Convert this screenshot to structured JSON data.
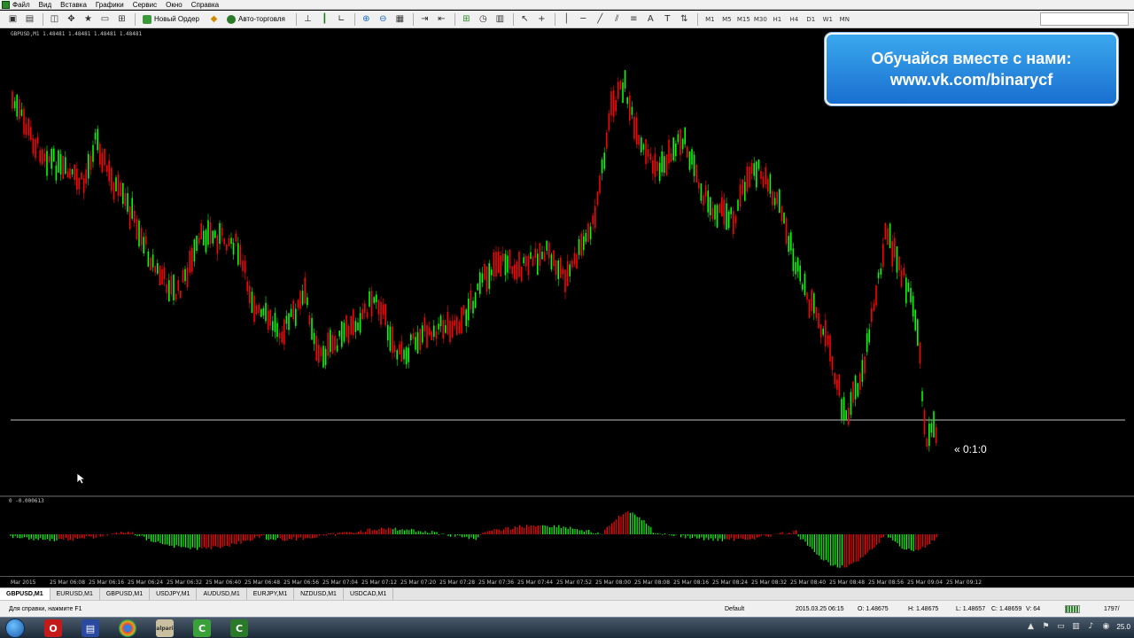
{
  "menu": [
    "Файл",
    "Вид",
    "Вставка",
    "Графики",
    "Сервис",
    "Окно",
    "Справка"
  ],
  "toolbar": {
    "new_order_label": "Новый Ордер",
    "autotrade_label": "Авто-торговля",
    "timeframes": [
      "M1",
      "M5",
      "M15",
      "M30",
      "H1",
      "H4",
      "D1",
      "W1",
      "MN"
    ]
  },
  "chart": {
    "title": "GBPUSD,M1  1.48481 1.48481 1.48481 1.48481",
    "timer": "« 0:1:0",
    "up_color": "#00ff00",
    "down_color": "#ff0000",
    "level_line_color": "#c0c0c0"
  },
  "banner": {
    "line1": "Обучайся вместе с нами:",
    "line2": "www.vk.com/binarycf"
  },
  "indicator": {
    "title": "0 -0.000613"
  },
  "time_axis": [
    "Mar 2015",
    "25 Mar 06:08",
    "25 Mar 06:16",
    "25 Mar 06:24",
    "25 Mar 06:32",
    "25 Mar 06:40",
    "25 Mar 06:48",
    "25 Mar 06:56",
    "25 Mar 07:04",
    "25 Mar 07:12",
    "25 Mar 07:20",
    "25 Mar 07:28",
    "25 Mar 07:36",
    "25 Mar 07:44",
    "25 Mar 07:52",
    "25 Mar 08:00",
    "25 Mar 08:08",
    "25 Mar 08:16",
    "25 Mar 08:24",
    "25 Mar 08:32",
    "25 Mar 08:40",
    "25 Mar 08:48",
    "25 Mar 08:56",
    "25 Mar 09:04",
    "25 Mar 09:12"
  ],
  "tabs": [
    "GBPUSD,M1",
    "EURUSD,M1",
    "GBPUSD,M1",
    "USDJPY,M1",
    "AUDUSD,M1",
    "EURJPY,M1",
    "NZDUSD,M1",
    "USDCAD,M1"
  ],
  "status": {
    "help": "Для справки, нажмите F1",
    "profile": "Default",
    "datetime": "2015.03.25 06:15",
    "open": "O: 1.48675",
    "high": "H: 1.48675",
    "low": "L: 1.48657",
    "close": "C: 1.48659",
    "volume": "V: 64",
    "traffic": "1797/"
  },
  "taskbar": {
    "clock": "25.0"
  }
}
